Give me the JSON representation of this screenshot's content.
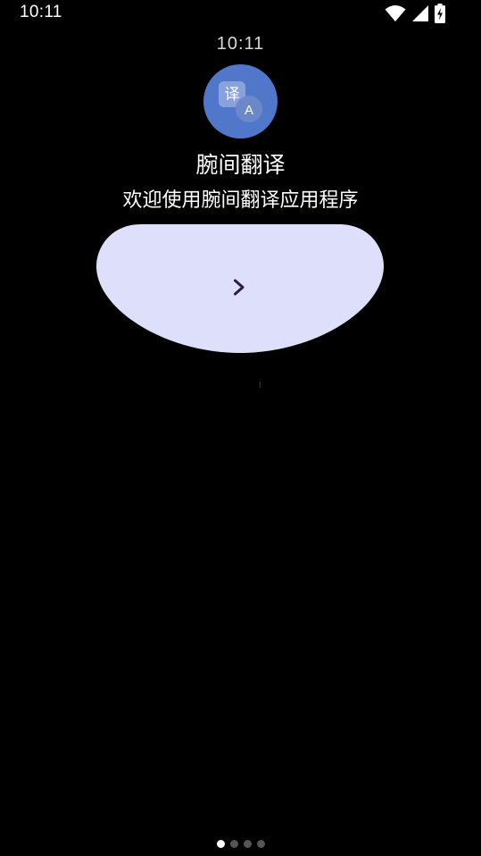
{
  "status_bar": {
    "time": "10:11",
    "icons": [
      "wifi-icon",
      "cell-signal-icon",
      "battery-charging-icon"
    ]
  },
  "watch": {
    "time": "10:11"
  },
  "app": {
    "icon_glyph_top": "译",
    "icon_glyph_bottom": "A",
    "name": "腕间翻译",
    "welcome": "欢迎使用腕间翻译应用程序"
  },
  "next_button": {
    "icon": "chevron-right-icon",
    "color": "#dedffb"
  },
  "pager": {
    "total": 4,
    "active": 1
  },
  "colors": {
    "app_icon_bg": "#5077c9",
    "button_bg": "#dedffb",
    "chevron": "#2a1f4a"
  }
}
